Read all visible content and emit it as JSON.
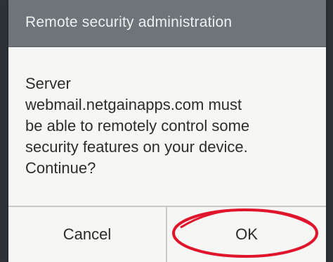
{
  "dialog": {
    "title": "Remote security administration",
    "message_lines": [
      "Server",
      "webmail.netgainapps.com must",
      "be able to remotely control some",
      "security features on your device.",
      "Continue?"
    ],
    "buttons": {
      "cancel_label": "Cancel",
      "ok_label": "OK"
    }
  },
  "colors": {
    "titlebar": "#6e747a",
    "dialog_bg": "#f6f6f4",
    "highlight_ring": "#e0142b"
  },
  "annotation": {
    "shape": "red-ellipse",
    "target": "ok-button"
  }
}
